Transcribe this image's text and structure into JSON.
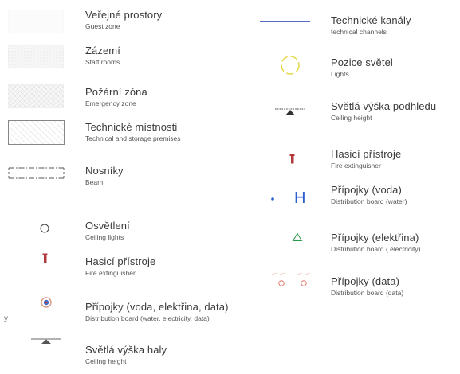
{
  "colors": {
    "text": "#3a3a3a",
    "blue": "#1f3fb5",
    "red": "#b23a3a",
    "green": "#2a9a4a",
    "yellow": "#e6d84a",
    "salmon": "#d8a090",
    "gray": "#9a9a9a"
  },
  "left": [
    {
      "cz": "Veřejné prostory",
      "en": "Guest zone",
      "icon": "guest-zone-swatch"
    },
    {
      "cz": "Zázemí",
      "en": "Staff rooms",
      "icon": "staff-rooms-swatch"
    },
    {
      "cz": "Požární zóna",
      "en": "Emergency zone",
      "icon": "emergency-zone-swatch"
    },
    {
      "cz": "Technické místnosti",
      "en": "Technical and storage premises",
      "icon": "technical-rooms-hatch"
    },
    {
      "cz": "Nosníky",
      "en": "Beam",
      "icon": "beam-dashdot-icon"
    },
    {
      "cz": "Osvětlení",
      "en": "Ceiling lights",
      "icon": "ceiling-light-icon"
    },
    {
      "cz": "Hasicí přístroje",
      "en": "Fire extinguisher",
      "icon": "fire-extinguisher-icon"
    },
    {
      "cz": "Přípojky (voda, elektřina, data)",
      "en": "Distribution board (water, electricity, data)",
      "icon": "distribution-board-icon"
    },
    {
      "cz": "Světlá výška haly",
      "en": "Ceiling height",
      "icon": "hall-height-icon"
    }
  ],
  "right": [
    {
      "cz": "Technické kanály",
      "en": "technical channels",
      "icon": "technical-channel-line"
    },
    {
      "cz": "Pozice světel",
      "en": "Lights",
      "icon": "light-position-icon"
    },
    {
      "cz": "Světlá výška podhledu",
      "en": "Ceiling height",
      "icon": "ceiling-height-icon"
    },
    {
      "cz": "Hasicí přístroje",
      "en": "Fire extinguisher",
      "icon": "fire-extinguisher-icon"
    },
    {
      "cz": "Přípojky (voda)",
      "en": "Distribution board (water)",
      "icon": "water-connection-icon"
    },
    {
      "cz": "Přípojky (elektřina)",
      "en": "Distribution board ( electricity)",
      "icon": "electricity-connection-icon"
    },
    {
      "cz": "Přípojky (data)",
      "en": "Distribution board (data)",
      "icon": "data-connection-icon"
    }
  ],
  "symbols": {
    "water_letter": "H",
    "stray_mark": "y"
  }
}
